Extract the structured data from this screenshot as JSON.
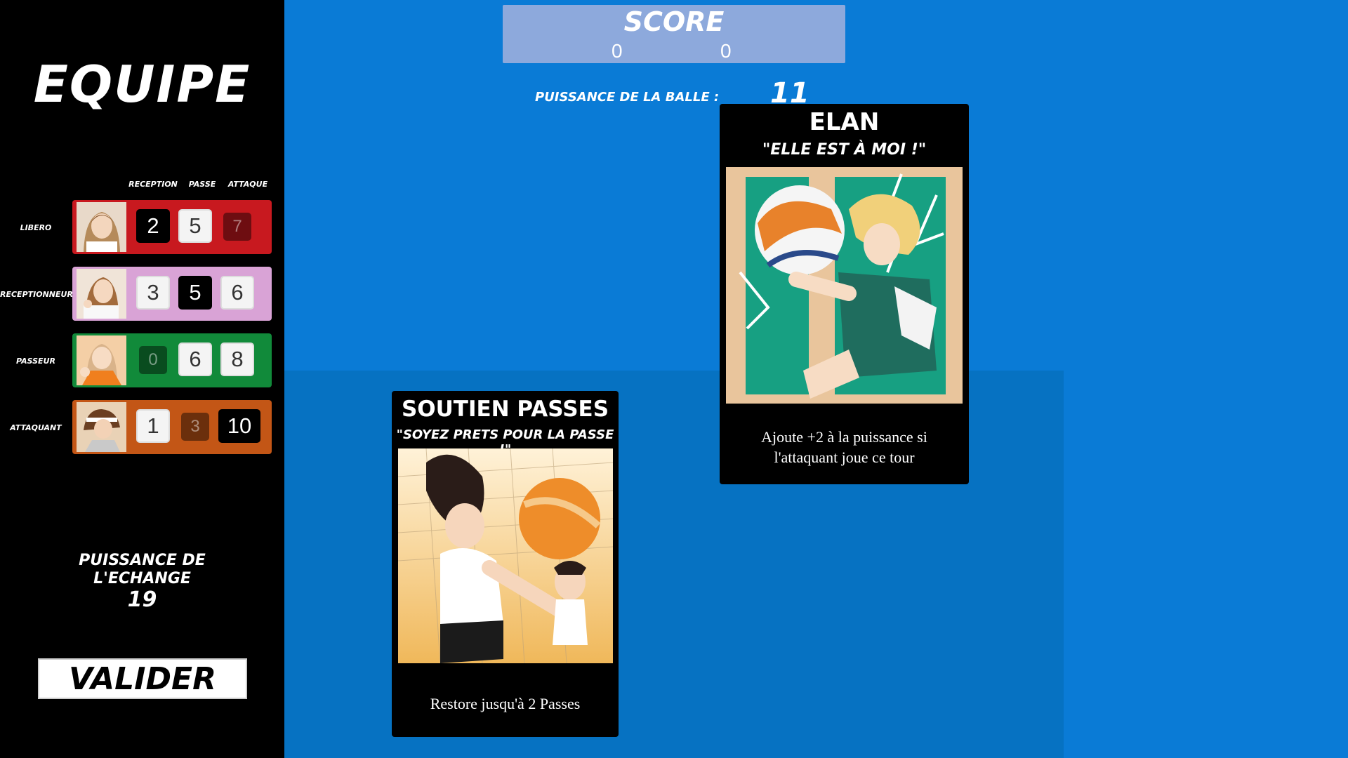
{
  "sidebar": {
    "title": "EQUIPE",
    "columns": [
      "RECEPTION",
      "PASSE",
      "ATTAQUE"
    ],
    "players": [
      {
        "role": "LIBERO",
        "color": "#c8191f",
        "avatar": "libero-avatar",
        "stats": [
          "2",
          "5",
          "7"
        ],
        "stat_styles": [
          "black",
          "white",
          "dim"
        ]
      },
      {
        "role": "RECEPTIONNEUR",
        "color": "#d9a3d6",
        "avatar": "receptionneur-avatar",
        "stats": [
          "3",
          "5",
          "6"
        ],
        "stat_styles": [
          "white",
          "black",
          "white"
        ]
      },
      {
        "role": "PASSEUR",
        "color": "#118a3a",
        "avatar": "passeur-avatar",
        "stats": [
          "0",
          "6",
          "8"
        ],
        "stat_styles": [
          "dim",
          "white",
          "white"
        ]
      },
      {
        "role": "ATTAQUANT",
        "color": "#c35616",
        "avatar": "attaquant-avatar",
        "stats": [
          "1",
          "3",
          "10"
        ],
        "stat_styles": [
          "white",
          "dim",
          "black"
        ]
      }
    ],
    "exchange_label_1": "PUISSANCE DE",
    "exchange_label_2": "L'ECHANGE",
    "exchange_value": "19",
    "validate_label": "VALIDER"
  },
  "score": {
    "title": "SCORE",
    "team_a": "0",
    "team_b": "0"
  },
  "ball_power": {
    "label": "PUISSANCE DE LA BALLE :",
    "value": "11"
  },
  "cards": {
    "soutien": {
      "title": "SOUTIEN PASSES",
      "quote": "\"SOYEZ PRETS POUR LA PASSE !\"",
      "art": "volleyball-setters-illustration",
      "description": "Restore jusqu'à 2 Passes"
    },
    "elan": {
      "title": "ELAN",
      "quote": "\"ELLE EST à MOI !\"",
      "art": "volleyball-spike-illustration",
      "description_1": "Ajoute +2 à la puissance si",
      "description_2": "l'attaquant joue ce tour"
    }
  },
  "colors": {
    "background": "#0a7bd6",
    "court": "#0672c2",
    "score_box": "#8da9dc"
  }
}
